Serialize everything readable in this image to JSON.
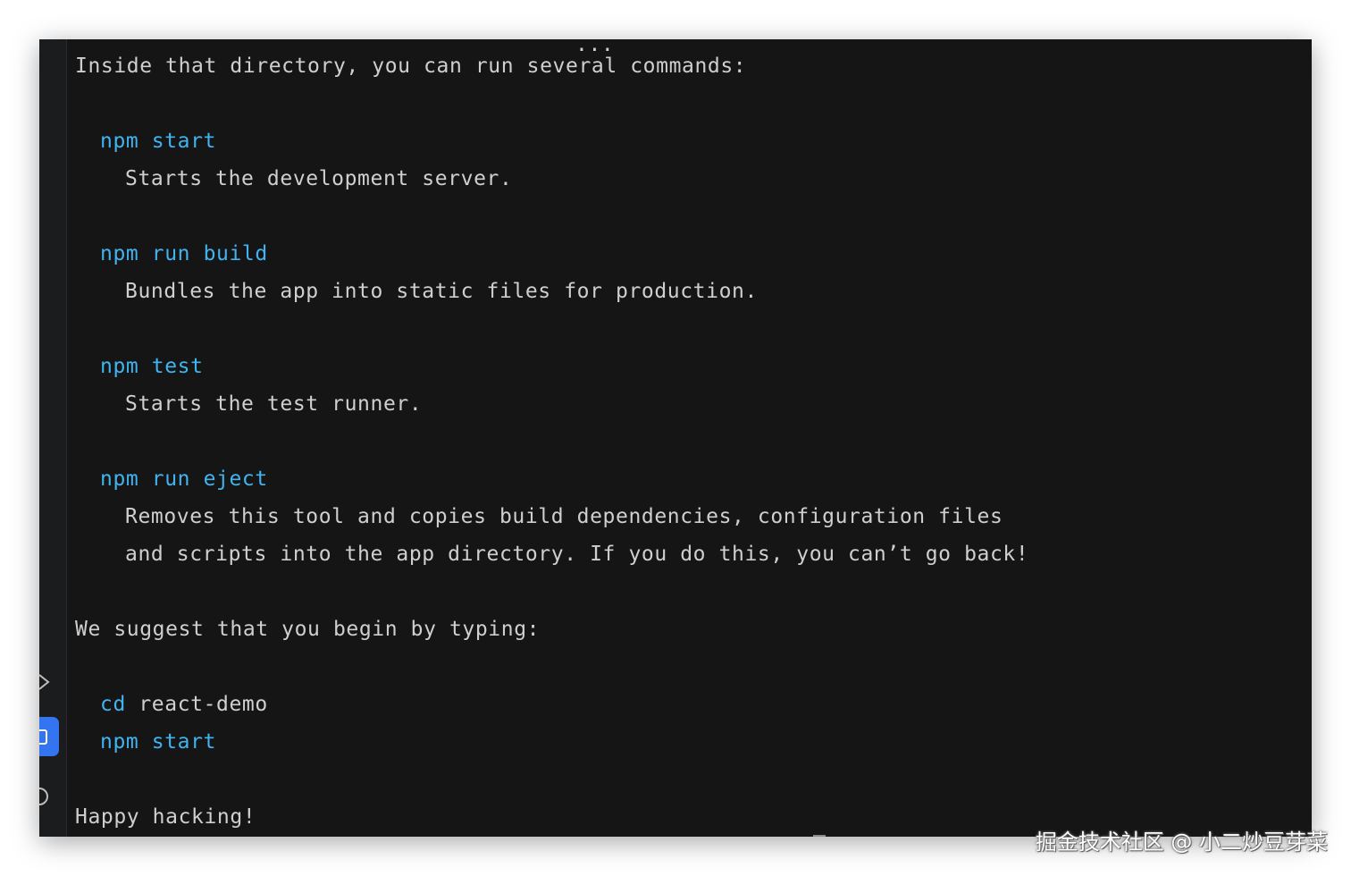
{
  "terminal": {
    "top_clipped": "...",
    "intro": "Inside that directory, you can run several commands:",
    "commands": [
      {
        "name": "npm start",
        "desc": [
          "Starts the development server."
        ]
      },
      {
        "name": "npm run build",
        "desc": [
          "Bundles the app into static files for production."
        ]
      },
      {
        "name": "npm test",
        "desc": [
          "Starts the test runner."
        ]
      },
      {
        "name": "npm run eject",
        "desc": [
          "Removes this tool and copies build dependencies, configuration files",
          "and scripts into the app directory. If you do this, you can’t go back!"
        ]
      }
    ],
    "suggest": "We suggest that you begin by typing:",
    "cd_cmd": "cd",
    "cd_arg": " react-demo",
    "start_cmd": "npm start",
    "outro": "Happy hacking!"
  },
  "gutter": {
    "icons": [
      "code-icon",
      "terminal-icon",
      "info-icon"
    ],
    "active": "terminal-icon",
    "accent": "#3574f0"
  },
  "colors": {
    "background": "#151515",
    "text": "#cfcfcf",
    "command": "#41b3ee"
  },
  "watermark": "掘金技术社区 @ 小二炒豆芽菜"
}
